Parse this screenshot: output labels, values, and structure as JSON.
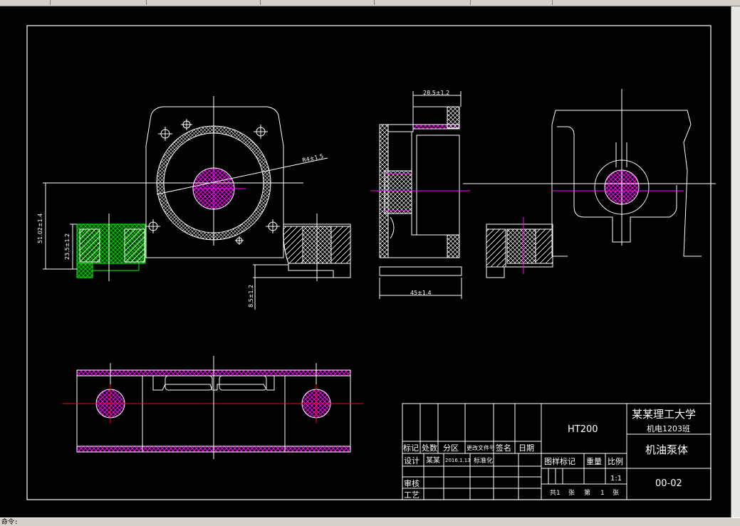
{
  "app": {
    "command_line": "命令:"
  },
  "drawing": {
    "dimensions": {
      "width_top": "28.5±1.2",
      "width_bottom": "45±1.4",
      "radius": "R4±1.5",
      "height_total": "51.02±1.4",
      "height_base": "23.5±1.2",
      "offset": "8.5±1.2"
    }
  },
  "title_block": {
    "material": "HT200",
    "school": "某某理工大学",
    "class_name": "机电1203班",
    "part_name": "机油泵体",
    "drawing_number": "00-02",
    "col_mark": "标记",
    "col_count": "处数",
    "col_zone": "分区",
    "col_doc": "更改文件号",
    "col_sign": "签名",
    "col_date": "日期",
    "design_label": "设计",
    "designer": "某某",
    "design_date": "2016.1.13",
    "standard_label": "标准化",
    "review_label": "审核",
    "process_label": "工艺",
    "stage_mark_label": "图样标记",
    "weight_label": "重量",
    "scale_label": "比例",
    "scale_value": "1:1",
    "sheet_total_prefix": "共1",
    "sheet_unit_1": "张",
    "sheet_current_prefix": "第",
    "sheet_current": "1",
    "sheet_unit_2": "张"
  }
}
